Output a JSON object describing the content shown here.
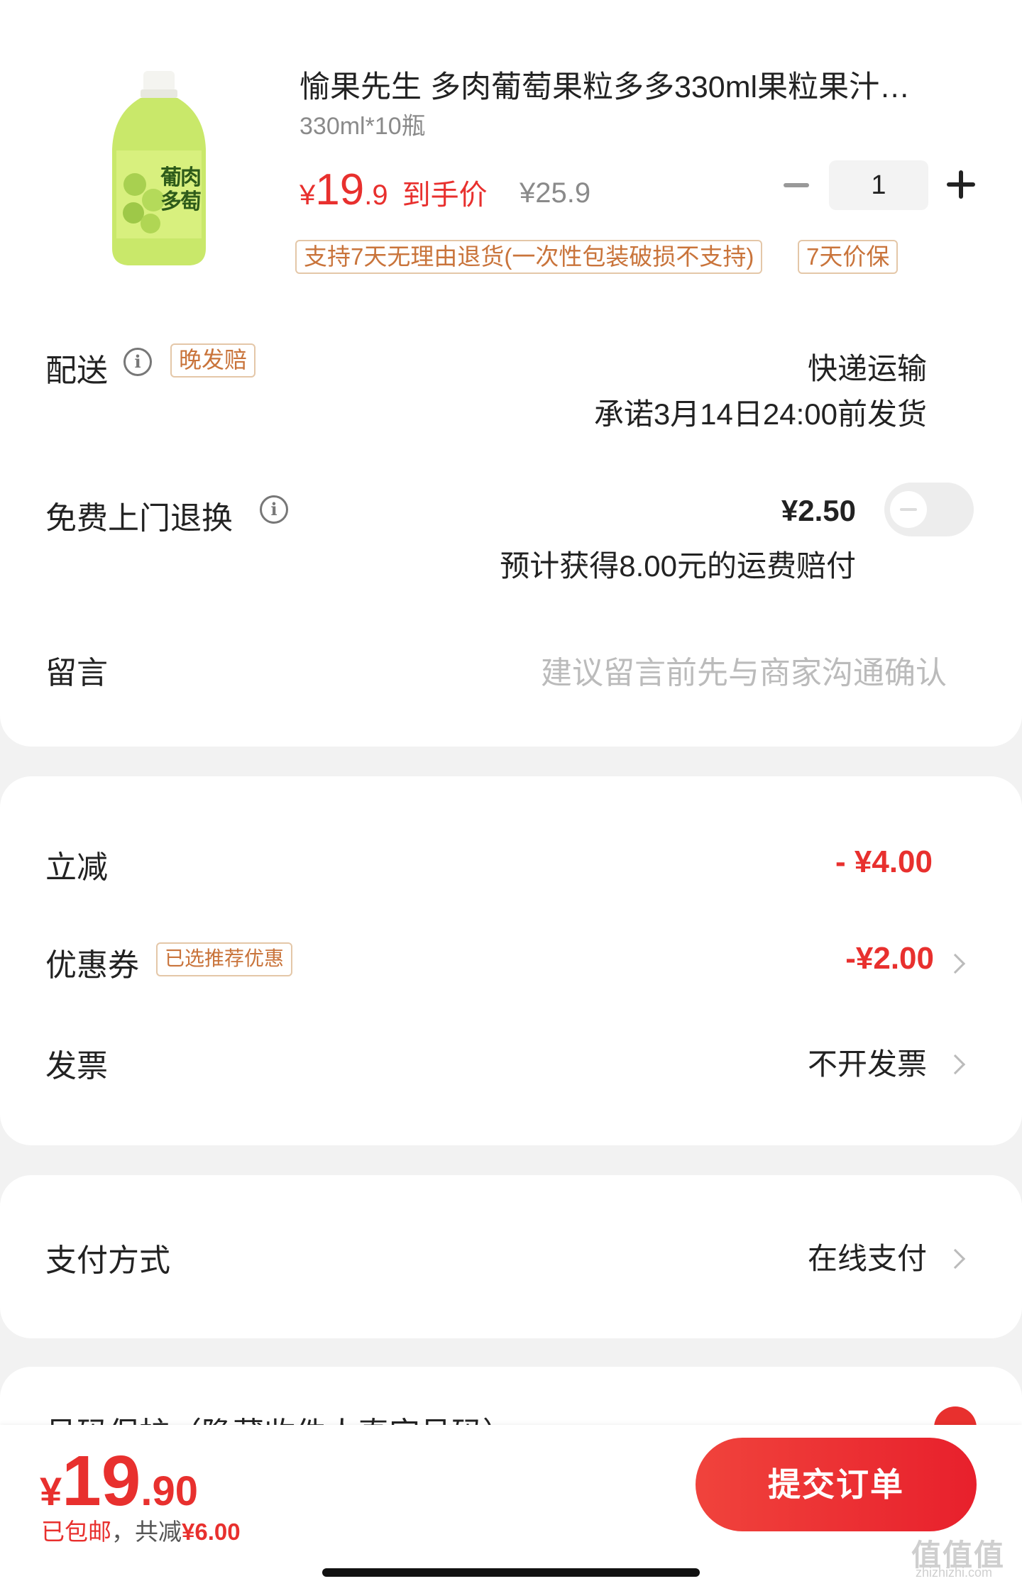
{
  "product": {
    "title": "愉果先生 多肉葡萄果粒多多330ml果粒果汁…",
    "spec": "330ml*10瓶",
    "price_yen": "¥",
    "price_int": "19",
    "price_dec": ".9",
    "price_tag": "到手价",
    "original_price": "¥25.9",
    "quantity": "1",
    "badges": [
      "支持7天无理由退货(一次性包装破损不支持)",
      "7天价保"
    ],
    "image_icon": "green-grape-juice-bottle"
  },
  "delivery": {
    "label": "配送",
    "tag": "晚发赔",
    "method": "快递运输",
    "promise": "承诺3月14日24:00前发货"
  },
  "return_service": {
    "label": "免费上门退换",
    "price": "¥2.50",
    "note": "预计获得8.00元的运费赔付",
    "enabled": false
  },
  "message": {
    "label": "留言",
    "placeholder": "建议留言前先与商家沟通确认"
  },
  "discounts": {
    "instant_label": "立减",
    "instant_value": "- ¥4.00",
    "coupon_label": "优惠券",
    "coupon_tag": "已选推荐优惠",
    "coupon_value": "-¥2.00",
    "invoice_label": "发票",
    "invoice_value": "不开发票"
  },
  "payment": {
    "label": "支付方式",
    "value": "在线支付"
  },
  "partial_row": {
    "text": "号码保护（隐藏收件人真实号码）"
  },
  "footer": {
    "total_yen": "¥",
    "total_int": "19",
    "total_dec": ".90",
    "shipping": "已包邮",
    "separator": "，",
    "saved_prefix": "共减",
    "saved_value": "¥6.00",
    "submit_label": "提交订单",
    "watermark": "值值值",
    "watermark_sub": "zhizhizhi.com"
  },
  "colors": {
    "accent_red": "#e8302e",
    "tag_orange": "#c9743b",
    "tag_border": "#e4c7a8"
  }
}
